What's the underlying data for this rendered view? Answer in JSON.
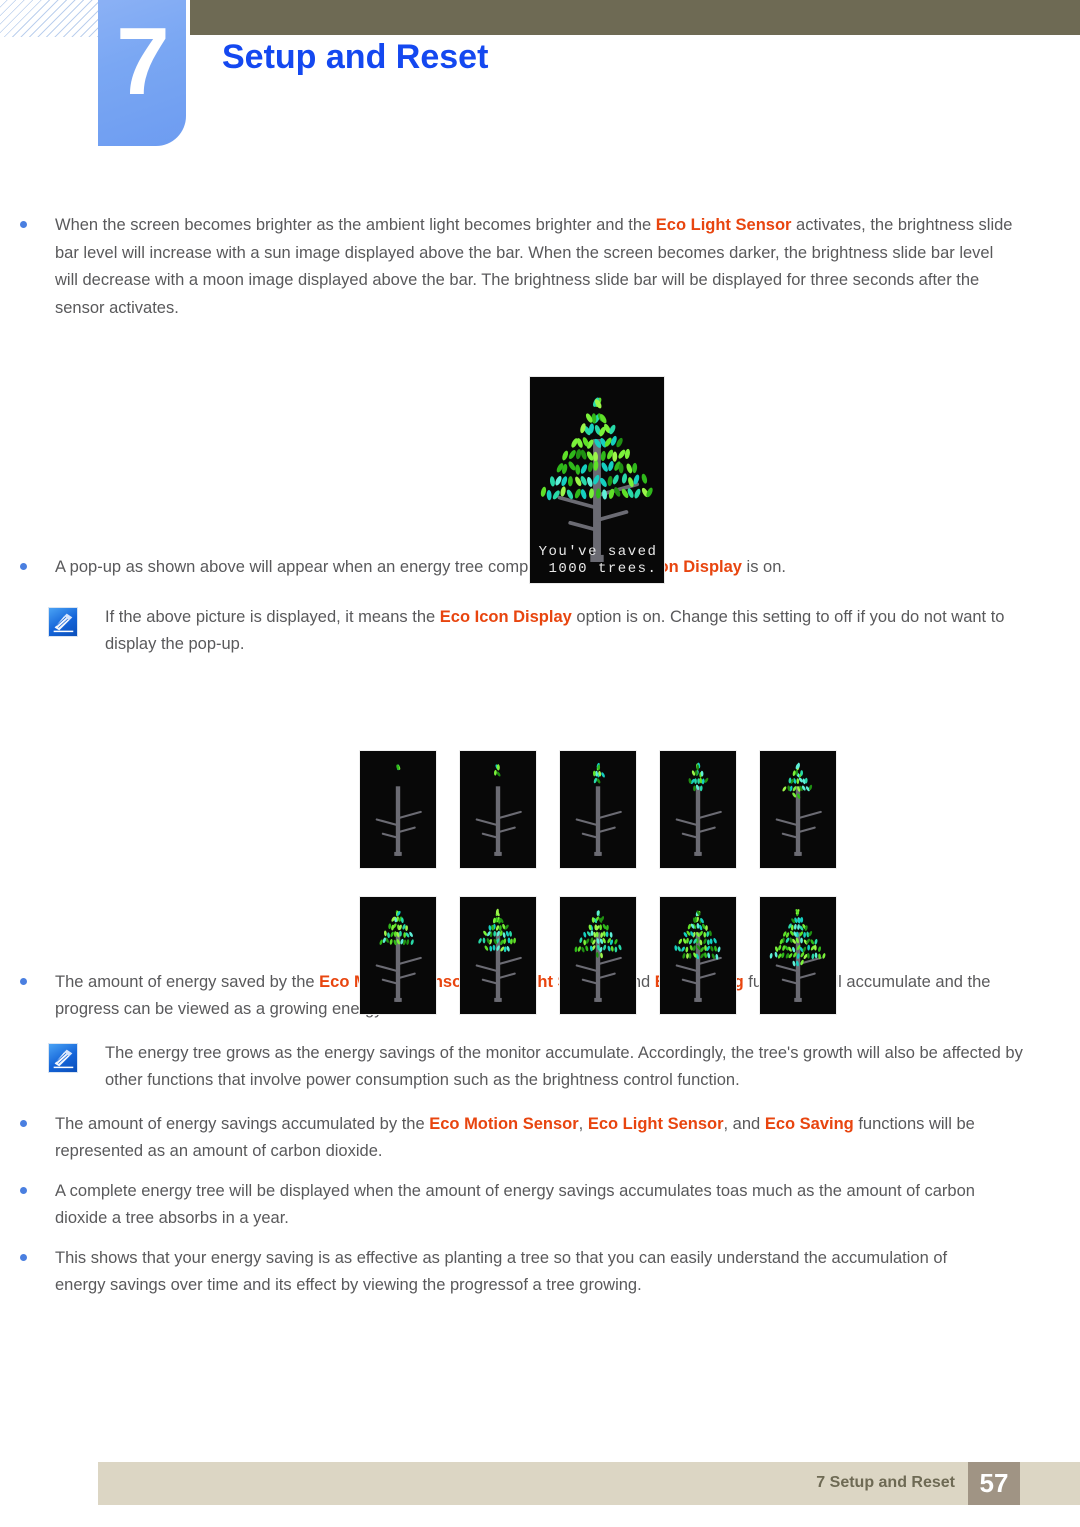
{
  "header": {
    "chapter_number": "7",
    "chapter_title": "Setup and Reset"
  },
  "bullets": [
    {
      "id": "eco-light-sensor-behavior",
      "segments": [
        {
          "t": "When the screen becomes brighter as the ambient light becomes brighter and the ",
          "hl": false
        },
        {
          "t": "Eco Light Sensor",
          "hl": true
        },
        {
          "t": " activates, the brightness slide bar level will increase with a sun image displayed above the bar. When the screen becomes darker, the brightness slide bar level will decrease with a moon image displayed above the bar. The brightness slide bar will be displayed for three seconds after the sensor activates.",
          "hl": false
        }
      ]
    },
    {
      "id": "popup-energy-tree-complete",
      "segments": [
        {
          "t": "A pop-up as shown above will appear when an energy tree completes while ",
          "hl": false
        },
        {
          "t": "Eco Icon Display",
          "hl": true
        },
        {
          "t": " is on.",
          "hl": false
        }
      ]
    },
    {
      "id": "energy-saved-accumulates",
      "segments": [
        {
          "t": "The amount of energy saved by the ",
          "hl": false
        },
        {
          "t": "Eco Motion Sensor",
          "hl": true
        },
        {
          "t": ", ",
          "hl": false
        },
        {
          "t": "Eco Light Sensor",
          "hl": true
        },
        {
          "t": ", and ",
          "hl": false
        },
        {
          "t": "Eco Saving",
          "hl": true
        },
        {
          "t": " functions will accumulate and the progress can be viewed as a growing energy tree.",
          "hl": false
        }
      ]
    },
    {
      "id": "savings-as-carbon-dioxide",
      "segments": [
        {
          "t": "The amount of energy savings accumulated by the ",
          "hl": false
        },
        {
          "t": "Eco Motion Sensor",
          "hl": true
        },
        {
          "t": ", ",
          "hl": false
        },
        {
          "t": "Eco Light Sensor",
          "hl": true
        },
        {
          "t": ", and ",
          "hl": false
        },
        {
          "t": "Eco Saving",
          "hl": true
        },
        {
          "t": " functions will be represented as an amount of carbon dioxide.",
          "hl": false
        }
      ]
    },
    {
      "id": "complete-energy-tree",
      "segments": [
        {
          "t": "A complete energy tree will be displayed when the amount of energy savings accumulates toas much as the amount of carbon dioxide a tree absorbs in a year.",
          "hl": false
        }
      ]
    },
    {
      "id": "planting-a-tree-analogy",
      "segments": [
        {
          "t": "This shows that your energy saving is as effective as planting a tree so that you can easily understand the accumulation of energy savings over time and its effect by viewing the progressof a tree growing.",
          "hl": false
        }
      ]
    }
  ],
  "notes": [
    {
      "id": "eco-icon-display-note",
      "icon": "note-pencil-icon",
      "segments": [
        {
          "t": "If the above picture is displayed, it means the ",
          "hl": false
        },
        {
          "t": "Eco Icon Display",
          "hl": true
        },
        {
          "t": " option is on. Change this setting to off if you do not want to display the pop-up.",
          "hl": false
        }
      ]
    },
    {
      "id": "tree-growth-note",
      "icon": "note-pencil-icon",
      "segments": [
        {
          "t": "The energy tree grows as the energy savings of the monitor accumulate. Accordingly, the tree's growth will also be affected by other functions that involve power consumption such as the brightness control function.",
          "hl": false
        }
      ]
    }
  ],
  "popup_image": {
    "name": "energy-tree-popup",
    "line1": "You've saved",
    "line2": " 1000 trees."
  },
  "tree_grid": {
    "name": "energy-tree-growth-stages",
    "rows": 2,
    "columns": 5,
    "stages": [
      {
        "label": "stage-1",
        "leaves": 3
      },
      {
        "label": "stage-2",
        "leaves": 5
      },
      {
        "label": "stage-3",
        "leaves": 10
      },
      {
        "label": "stage-4",
        "leaves": 18
      },
      {
        "label": "stage-5",
        "leaves": 26
      },
      {
        "label": "stage-6",
        "leaves": 34
      },
      {
        "label": "stage-7",
        "leaves": 42
      },
      {
        "label": "stage-8",
        "leaves": 50
      },
      {
        "label": "stage-9",
        "leaves": 58
      },
      {
        "label": "stage-10",
        "leaves": 66
      }
    ]
  },
  "footer": {
    "label": "7 Setup and Reset",
    "page_number": "57"
  },
  "colors": {
    "highlight": "#e8450f",
    "body_text": "#59595b",
    "chapter_title": "#1448f0",
    "chapter_block": "#7aa7f3",
    "olive_bar": "#6e6a54",
    "footer_bar": "#dcd6c4",
    "footer_page_bg": "#a09484",
    "bullet": "#4a7fe0"
  }
}
